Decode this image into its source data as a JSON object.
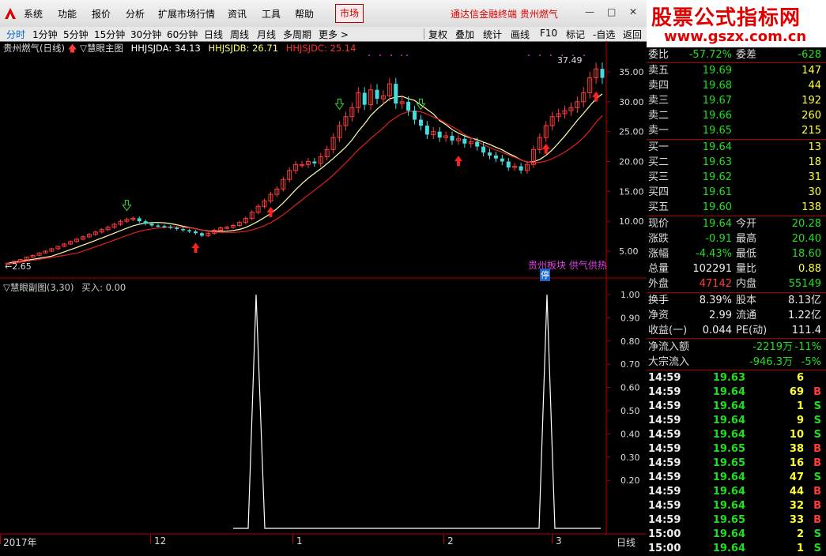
{
  "menubar": {
    "items": [
      "系统",
      "功能",
      "报价",
      "分析",
      "扩展市场行情",
      "资讯",
      "工具",
      "帮助"
    ],
    "market_label": "市场",
    "app_title": "通达信金融终端  贵州燃气",
    "win_controls": [
      "—",
      "□",
      "✕"
    ]
  },
  "watermark": {
    "line1": "股票公式指标网",
    "line2": "www.gszx.com.cn"
  },
  "periods": [
    {
      "label": "分时",
      "active": true
    },
    {
      "label": "1分钟"
    },
    {
      "label": "5分钟"
    },
    {
      "label": "15分钟"
    },
    {
      "label": "30分钟"
    },
    {
      "label": "60分钟"
    },
    {
      "label": "日线"
    },
    {
      "label": "周线"
    },
    {
      "label": "月线"
    },
    {
      "label": "多周期"
    },
    {
      "label": "更多 >"
    }
  ],
  "tools": [
    "复权",
    "叠加",
    "统计",
    "画线",
    "F10",
    "标记",
    "-自选",
    "返回"
  ],
  "main_chart": {
    "stock": "贵州燃气(日线)",
    "indicator_name": "慧眼主图",
    "hhjsjda": "HHJSJDA: 34.13",
    "hhjsjdb": "HHJSJDB: 26.71",
    "hhjsjdc": "HHJSJDC: 25.14",
    "y_ticks": [
      "35.00",
      "30.00",
      "25.00",
      "20.00",
      "15.00",
      "10.00",
      "5.00"
    ],
    "high_label": "37.49",
    "low_label": "2.65",
    "notes": [
      "贵州板块 供气供热",
      "停"
    ]
  },
  "sub_chart": {
    "title": "慧眼副图(3,30)",
    "buy_label": "买入: 0.00",
    "y_ticks": [
      "1.00",
      "0.90",
      "0.80",
      "0.70",
      "0.60",
      "0.50",
      "0.40",
      "0.30",
      "0.20"
    ]
  },
  "timebar": {
    "labels": [
      "2017年",
      "12",
      "1",
      "2",
      "3"
    ],
    "period": "日线"
  },
  "order_book": {
    "weibi_label": "委比",
    "weibi_value": "-57.72%",
    "weicha_label": "委差",
    "weicha_value": "-628",
    "asks": [
      {
        "label": "卖五",
        "price": "19.69",
        "vol": "147"
      },
      {
        "label": "卖四",
        "price": "19.68",
        "vol": "44"
      },
      {
        "label": "卖三",
        "price": "19.67",
        "vol": "192"
      },
      {
        "label": "卖二",
        "price": "19.66",
        "vol": "260"
      },
      {
        "label": "卖一",
        "price": "19.65",
        "vol": "215"
      }
    ],
    "bids": [
      {
        "label": "买一",
        "price": "19.64",
        "vol": "13"
      },
      {
        "label": "买二",
        "price": "19.63",
        "vol": "18"
      },
      {
        "label": "买三",
        "price": "19.62",
        "vol": "31"
      },
      {
        "label": "买四",
        "price": "19.61",
        "vol": "30"
      },
      {
        "label": "买五",
        "price": "19.60",
        "vol": "138"
      }
    ]
  },
  "quote_stats": [
    {
      "l1": "现价",
      "v1": "19.64",
      "c1": "green",
      "l2": "今开",
      "v2": "20.28",
      "c2": "green"
    },
    {
      "l1": "涨跌",
      "v1": "-0.91",
      "c1": "green",
      "l2": "最高",
      "v2": "20.40",
      "c2": "green"
    },
    {
      "l1": "涨幅",
      "v1": "-4.43%",
      "c1": "green",
      "l2": "最低",
      "v2": "18.60",
      "c2": "green"
    },
    {
      "l1": "总量",
      "v1": "102291",
      "c1": "white",
      "l2": "量比",
      "v2": "0.88",
      "c2": "yellow"
    },
    {
      "l1": "外盘",
      "v1": "47142",
      "c1": "red",
      "l2": "内盘",
      "v2": "55149",
      "c2": "green"
    }
  ],
  "fin_stats": [
    {
      "l1": "换手",
      "v1": "8.39%",
      "l2": "股本",
      "v2": "8.13亿"
    },
    {
      "l1": "净资",
      "v1": "2.99",
      "l2": "流通",
      "v2": "1.22亿"
    },
    {
      "l1": "收益(一)",
      "v1": "0.044",
      "l2": "PE(动)",
      "v2": "111.4"
    }
  ],
  "flow": [
    {
      "label": "净流入额",
      "value": "-2219万",
      "pct": "-11%"
    },
    {
      "label": "大宗流入",
      "value": "-946.3万",
      "pct": "-5%"
    }
  ],
  "ticks": [
    {
      "time": "14:59",
      "price": "19.63",
      "vol": "6",
      "side": ""
    },
    {
      "time": "14:59",
      "price": "19.64",
      "vol": "69",
      "side": "B"
    },
    {
      "time": "14:59",
      "price": "19.64",
      "vol": "1",
      "side": "S"
    },
    {
      "time": "14:59",
      "price": "19.64",
      "vol": "9",
      "side": "S"
    },
    {
      "time": "14:59",
      "price": "19.64",
      "vol": "10",
      "side": "S"
    },
    {
      "time": "14:59",
      "price": "19.65",
      "vol": "38",
      "side": "B"
    },
    {
      "time": "14:59",
      "price": "19.65",
      "vol": "16",
      "side": "B"
    },
    {
      "time": "14:59",
      "price": "19.64",
      "vol": "47",
      "side": "S"
    },
    {
      "time": "14:59",
      "price": "19.64",
      "vol": "44",
      "side": "B"
    },
    {
      "time": "14:59",
      "price": "19.64",
      "vol": "32",
      "side": "B"
    },
    {
      "time": "14:59",
      "price": "19.65",
      "vol": "33",
      "side": "B"
    },
    {
      "time": "15:00",
      "price": "19.64",
      "vol": "2",
      "side": "S"
    },
    {
      "time": "15:00",
      "price": "19.64",
      "vol": "1",
      "side": "S"
    }
  ],
  "colors": {
    "up": "#ff3c3c",
    "down": "#44dddd",
    "ma1": "#ffffaa",
    "ma2": "#e02020",
    "axis": "#b00000"
  }
}
